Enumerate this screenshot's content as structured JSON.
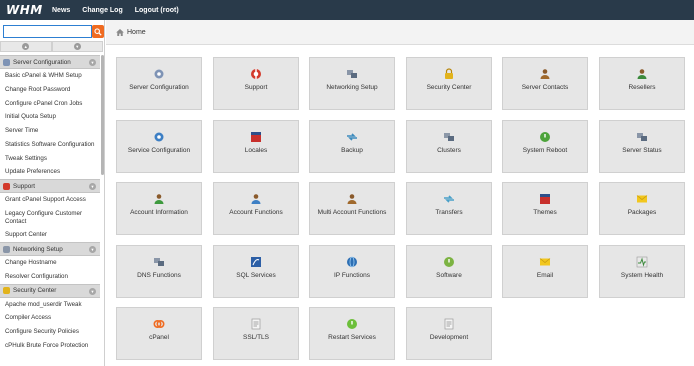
{
  "topbar": {
    "logo": "WHM",
    "nav": [
      "News",
      "Change Log",
      "Logout (root)"
    ]
  },
  "sidebar": {
    "search": {
      "value": "",
      "placeholder": ""
    },
    "groups": [
      {
        "label": "Server Configuration",
        "icon": "gear-icon",
        "color": "#7e93b5",
        "items": [
          "Basic cPanel & WHM Setup",
          "Change Root Password",
          "Configure cPanel Cron Jobs",
          "Initial Quota Setup",
          "Server Time",
          "Statistics Software Configuration",
          "Tweak Settings",
          "Update Preferences"
        ]
      },
      {
        "label": "Support",
        "icon": "lifebuoy-icon",
        "color": "#d33a2c",
        "items": [
          "Grant cPanel Support Access",
          "Legacy Configure Customer Contact",
          "Support Center"
        ]
      },
      {
        "label": "Networking Setup",
        "icon": "network-icon",
        "color": "#8a96a8",
        "items": [
          "Change Hostname",
          "Resolver Configuration"
        ]
      },
      {
        "label": "Security Center",
        "icon": "lock-icon",
        "color": "#e2b31c",
        "items": [
          "Apache mod_userdir Tweak",
          "Compiler Access",
          "Configure Security Policies",
          "cPHulk Brute Force Protection"
        ]
      }
    ]
  },
  "breadcrumb": {
    "label": "Home"
  },
  "tiles": [
    {
      "label": "Server Configuration",
      "icon": "gear-icon",
      "color": "#7e93b5"
    },
    {
      "label": "Support",
      "icon": "lifebuoy-icon",
      "color": "#d33a2c"
    },
    {
      "label": "Networking Setup",
      "icon": "network-icon",
      "color": "#8a96a8"
    },
    {
      "label": "Security Center",
      "icon": "lock-icon",
      "color": "#e2b31c"
    },
    {
      "label": "Server Contacts",
      "icon": "contact-icon",
      "color": "#a0692c"
    },
    {
      "label": "Resellers",
      "icon": "users-icon",
      "color": "#3c8a3c"
    },
    {
      "label": "Service Configuration",
      "icon": "cog-icon",
      "color": "#3d7fc4"
    },
    {
      "label": "Locales",
      "icon": "flag-icon",
      "color": "#c8302c"
    },
    {
      "label": "Backup",
      "icon": "backup-icon",
      "color": "#3d8bbd"
    },
    {
      "label": "Clusters",
      "icon": "cluster-icon",
      "color": "#8c98a8"
    },
    {
      "label": "System Reboot",
      "icon": "power-icon",
      "color": "#4ca33a"
    },
    {
      "label": "Server Status",
      "icon": "status-icon",
      "color": "#8a96a8"
    },
    {
      "label": "Account Information",
      "icon": "account-info-icon",
      "color": "#3e9a3e"
    },
    {
      "label": "Account Functions",
      "icon": "account-functions-icon",
      "color": "#3d7fc4"
    },
    {
      "label": "Multi Account Functions",
      "icon": "multi-account-icon",
      "color": "#a0692c"
    },
    {
      "label": "Transfers",
      "icon": "transfer-icon",
      "color": "#4aa0c8"
    },
    {
      "label": "Themes",
      "icon": "theme-icon",
      "color": "#c8302c"
    },
    {
      "label": "Packages",
      "icon": "package-icon",
      "color": "#f2c71e"
    },
    {
      "label": "DNS Functions",
      "icon": "dns-icon",
      "color": "#8a96a8"
    },
    {
      "label": "SQL Services",
      "icon": "sql-icon",
      "color": "#2d5fa6"
    },
    {
      "label": "IP Functions",
      "icon": "globe-icon",
      "color": "#2d6fb4"
    },
    {
      "label": "Software",
      "icon": "software-icon",
      "color": "#7cb342"
    },
    {
      "label": "Email",
      "icon": "email-icon",
      "color": "#f2c71e"
    },
    {
      "label": "System Health",
      "icon": "health-icon",
      "color": "#3c8a3c"
    },
    {
      "label": "cPanel",
      "icon": "cpanel-icon",
      "color": "#f06b21"
    },
    {
      "label": "SSL/TLS",
      "icon": "certificate-icon",
      "color": "#c9c9c9"
    },
    {
      "label": "Restart Services",
      "icon": "restart-icon",
      "color": "#6cbf3a"
    },
    {
      "label": "Development",
      "icon": "development-icon",
      "color": "#c9c9c9"
    }
  ]
}
